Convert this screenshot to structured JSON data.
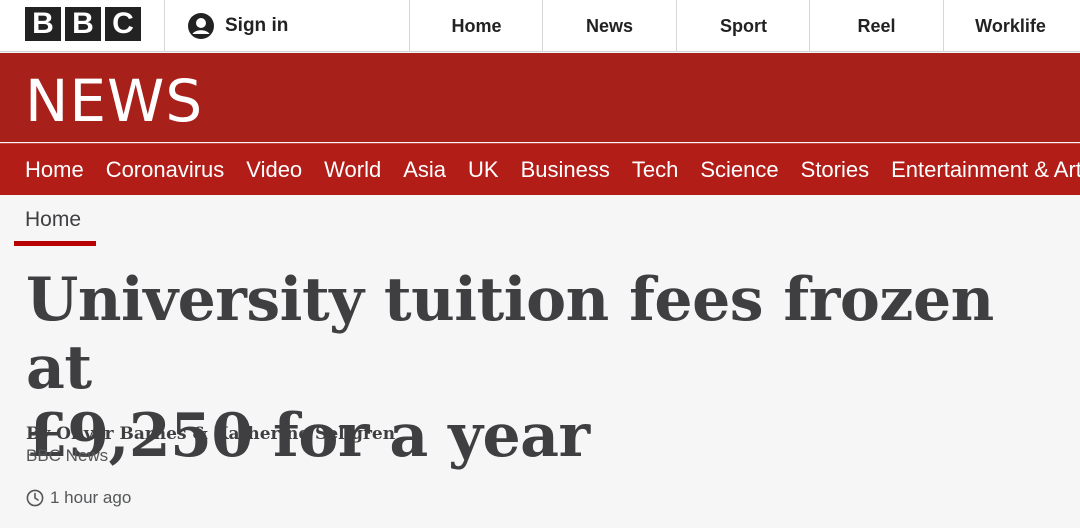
{
  "masthead": {
    "logo_letters": [
      "B",
      "B",
      "C"
    ],
    "signin_label": "Sign in",
    "nav": [
      "Home",
      "News",
      "Sport",
      "Reel",
      "Worklife"
    ]
  },
  "banner": {
    "title": "NEWS",
    "color": "#a8201a"
  },
  "section_nav": {
    "items": [
      "Home",
      "Coronavirus",
      "Video",
      "World",
      "Asia",
      "UK",
      "Business",
      "Tech",
      "Science",
      "Stories",
      "Entertainment & Arts"
    ]
  },
  "breadcrumb": {
    "label": "Home"
  },
  "article": {
    "headline_line1": "University tuition fees frozen at",
    "headline_line2": "£9,250 for a year",
    "byline": "By Oliver Barnes & Katherine Sellgren",
    "source": "BBC News",
    "timestamp": "1 hour ago"
  },
  "icons": {
    "signin": "user-icon",
    "timestamp": "clock-icon"
  },
  "colors": {
    "brand_red": "#b21d18",
    "breadcrumb_accent": "#b80000"
  }
}
